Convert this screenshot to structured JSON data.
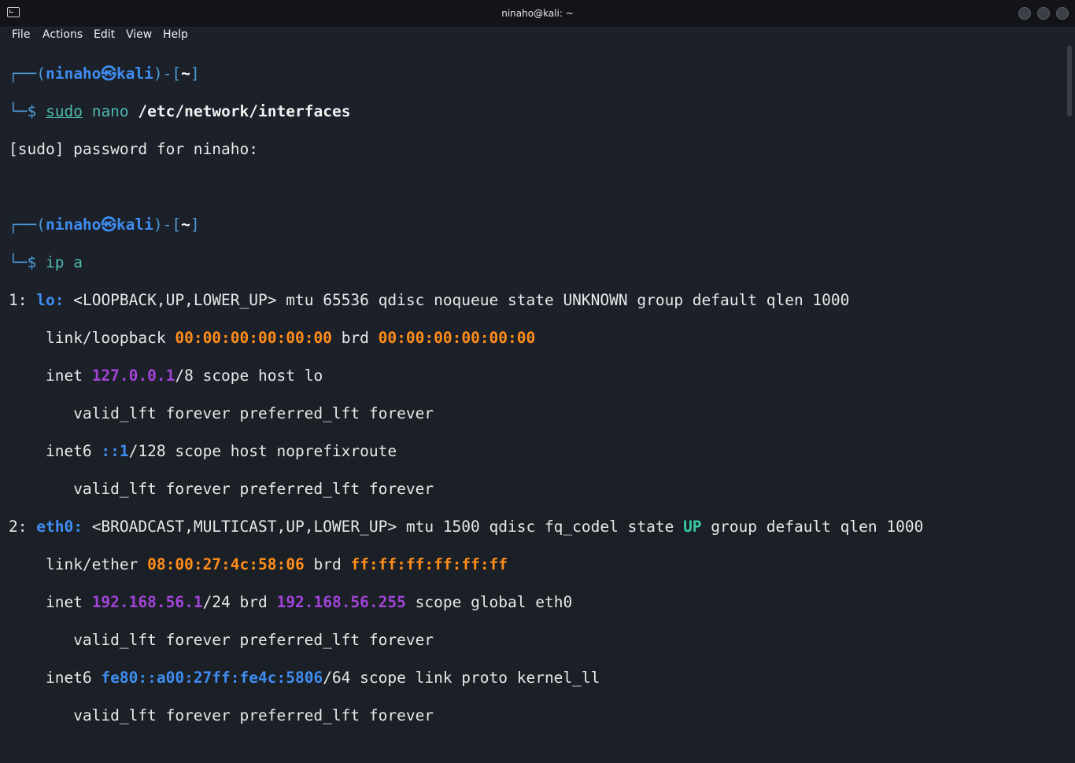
{
  "window": {
    "title": "ninaho@kali: ~"
  },
  "menu": [
    "File",
    "Actions",
    "Edit",
    "View",
    "Help"
  ],
  "prompt": {
    "open": "┌──(",
    "user": "ninaho",
    "at": "㉿",
    "host": "kali",
    "mid": ")-[",
    "dir": "~",
    "close": "]",
    "dollar_prefix": "└─$"
  },
  "lines": {
    "cmd1_sudo": "sudo",
    "cmd1_nano": "nano",
    "cmd1_path": "/etc/network/interfaces",
    "sudo_prompt": "[sudo] password for ninaho:",
    "cmd2_ip": "ip",
    "cmd2_arg": "a",
    "lo_num": "1:",
    "lo_name": "lo:",
    "lo_flags": "<LOOPBACK,UP,LOWER_UP> mtu 65536 qdisc noqueue state UNKNOWN group default qlen 1000",
    "lo_link_label": "link/loopback",
    "lo_mac": "00:00:00:00:00:00",
    "lo_brd_label": "brd",
    "lo_brd": "00:00:00:00:00:00",
    "lo_inet_label": "inet",
    "lo_inet": "127.0.0.1",
    "lo_inet_rest": "/8 scope host lo",
    "valid1": "valid_lft forever preferred_lft forever",
    "lo_inet6_label": "inet6",
    "lo_inet6": "::1",
    "lo_inet6_rest": "/128 scope host noprefixroute",
    "valid2": "valid_lft forever preferred_lft forever",
    "eth_num": "2:",
    "eth_name": "eth0:",
    "eth_flags_a": "<BROADCAST,MULTICAST,UP,LOWER_UP> mtu 1500 qdisc fq_codel state",
    "eth_state": "UP",
    "eth_flags_b": "group default qlen 1000",
    "eth_link_label": "link/ether",
    "eth_mac": "08:00:27:4c:58:06",
    "eth_brd_label": "brd",
    "eth_brd": "ff:ff:ff:ff:ff:ff",
    "eth_inet_label": "inet",
    "eth_inet": "192.168.56.1",
    "eth_inet_mid": "/24 brd",
    "eth_inet_brd": "192.168.56.255",
    "eth_inet_rest": "scope global eth0",
    "valid3": "valid_lft forever preferred_lft forever",
    "eth_inet6_label": "inet6",
    "eth_inet6": "fe80::a00:27ff:fe4c:5806",
    "eth_inet6_rest": "/64 scope link proto kernel_ll",
    "valid4": "valid_lft forever preferred_lft forever"
  },
  "colors": {
    "prompt": "#4c9bd9",
    "user_host": "#3f8df0",
    "command": "#4dbab0",
    "mac": "#ff8d1a",
    "ipv4": "#a244d8",
    "ipv6": "#3f8df0",
    "state_up": "#39c9a0"
  }
}
